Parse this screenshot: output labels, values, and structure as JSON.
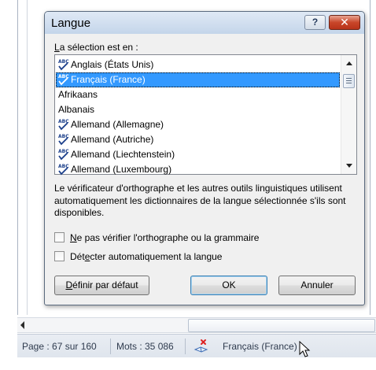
{
  "dialog": {
    "title": "Langue",
    "help_button": "?",
    "close_button": "✕",
    "selection_label_prefix": "L",
    "selection_label_rest": "a sélection est en :",
    "languages": [
      {
        "label": "Anglais (États Unis)",
        "spellcheck": true,
        "selected": false
      },
      {
        "label": "Français (France)",
        "spellcheck": true,
        "selected": true
      },
      {
        "label": "Afrikaans",
        "spellcheck": false,
        "selected": false
      },
      {
        "label": "Albanais",
        "spellcheck": false,
        "selected": false
      },
      {
        "label": "Allemand (Allemagne)",
        "spellcheck": true,
        "selected": false
      },
      {
        "label": "Allemand (Autriche)",
        "spellcheck": true,
        "selected": false
      },
      {
        "label": "Allemand (Liechtenstein)",
        "spellcheck": true,
        "selected": false
      },
      {
        "label": "Allemand (Luxembourg)",
        "spellcheck": true,
        "selected": false
      }
    ],
    "info_text": "Le vérificateur d'orthographe et les autres outils linguistiques utilisent automatiquement les dictionnaires de la langue sélectionnée s'ils sont disponibles.",
    "checkbox_no_check": {
      "prefix": "N",
      "rest": "e pas vérifier l'orthographe ou la grammaire",
      "checked": false
    },
    "checkbox_detect": {
      "before": "Dét",
      "key": "e",
      "after": "cter automatiquement la langue",
      "checked": false
    },
    "btn_default": {
      "key": "D",
      "rest": "éfinir par défaut"
    },
    "btn_ok": "OK",
    "btn_cancel": "Annuler"
  },
  "statusbar": {
    "page": "Page : 67 sur 160",
    "words": "Mots : 35 086",
    "language": "Français (France)"
  },
  "colors": {
    "selection": "#3399ff",
    "close_red": "#c9462a",
    "status_text": "#2f3b4e"
  }
}
